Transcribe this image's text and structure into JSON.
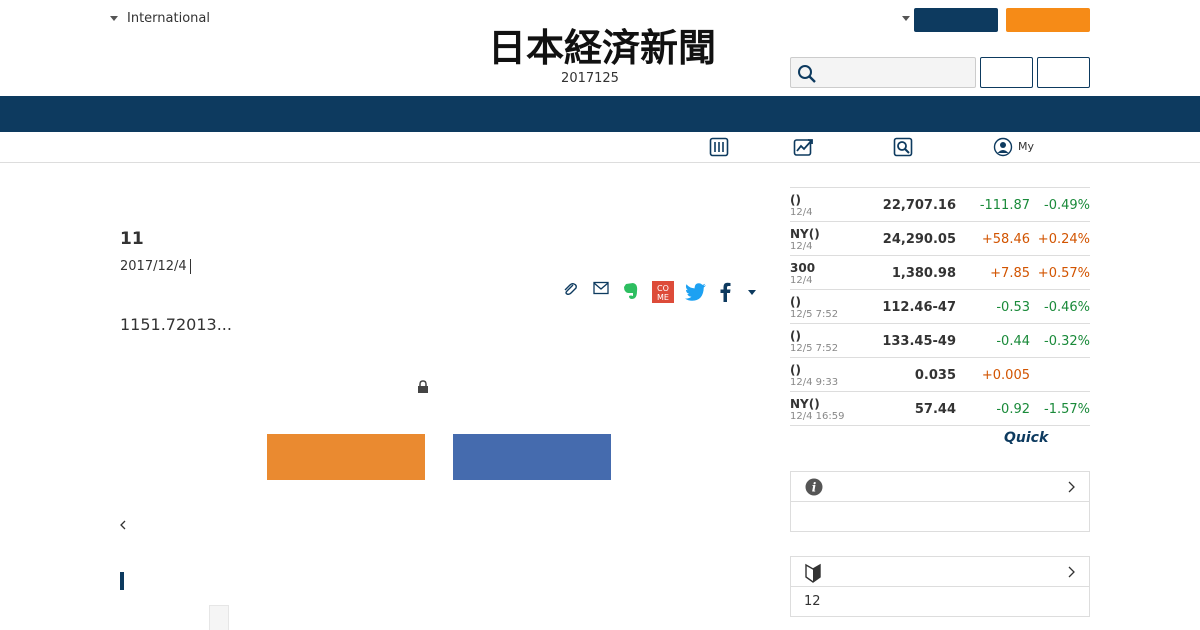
{
  "header": {
    "edition_label": "International",
    "logo_text": "日本経済新聞",
    "date": "2017125"
  },
  "subnav": {
    "items": [
      {
        "icon": "grid-icon",
        "label": ""
      },
      {
        "icon": "chart-icon",
        "label": ""
      },
      {
        "icon": "search-doc-icon",
        "label": ""
      },
      {
        "icon": "user-icon",
        "label": "My"
      }
    ]
  },
  "article": {
    "title": "11",
    "date": "2017/12/4",
    "lead": "1151.72013..."
  },
  "market": {
    "rows": [
      {
        "name": "()",
        "time": "12/4",
        "value": "22,707.16",
        "change": "-111.87",
        "pct": "-0.49%",
        "dir": "down"
      },
      {
        "name": "NY()",
        "time": "12/4",
        "value": "24,290.05",
        "change": "+58.46",
        "pct": "+0.24%",
        "dir": "up"
      },
      {
        "name": "300",
        "time": "12/4",
        "value": "1,380.98",
        "change": "+7.85",
        "pct": "+0.57%",
        "dir": "up"
      },
      {
        "name": "()",
        "time": "12/5 7:52",
        "value": "112.46-47",
        "change": "-0.53",
        "pct": "-0.46%",
        "dir": "down"
      },
      {
        "name": "()",
        "time": "12/5 7:52",
        "value": "133.45-49",
        "change": "-0.44",
        "pct": "-0.32%",
        "dir": "down"
      },
      {
        "name": "()",
        "time": "12/4 9:33",
        "value": "0.035",
        "change": "+0.005",
        "pct": "",
        "dir": "up"
      },
      {
        "name": "NY()",
        "time": "12/4 16:59",
        "value": "57.44",
        "change": "-0.92",
        "pct": "-1.57%",
        "dir": "down"
      }
    ],
    "source_logo": "Quick"
  },
  "panels": [
    {
      "icon": "info-icon",
      "text": ""
    },
    {
      "icon": "beginner-mark-icon",
      "text": "12"
    }
  ],
  "colors": {
    "navy": "#0d3a5f",
    "orange": "#f68b17",
    "cta_orange": "#ea8a30",
    "cta_blue": "#456bae",
    "positive": "#d25400",
    "negative": "#1a8a3a"
  }
}
